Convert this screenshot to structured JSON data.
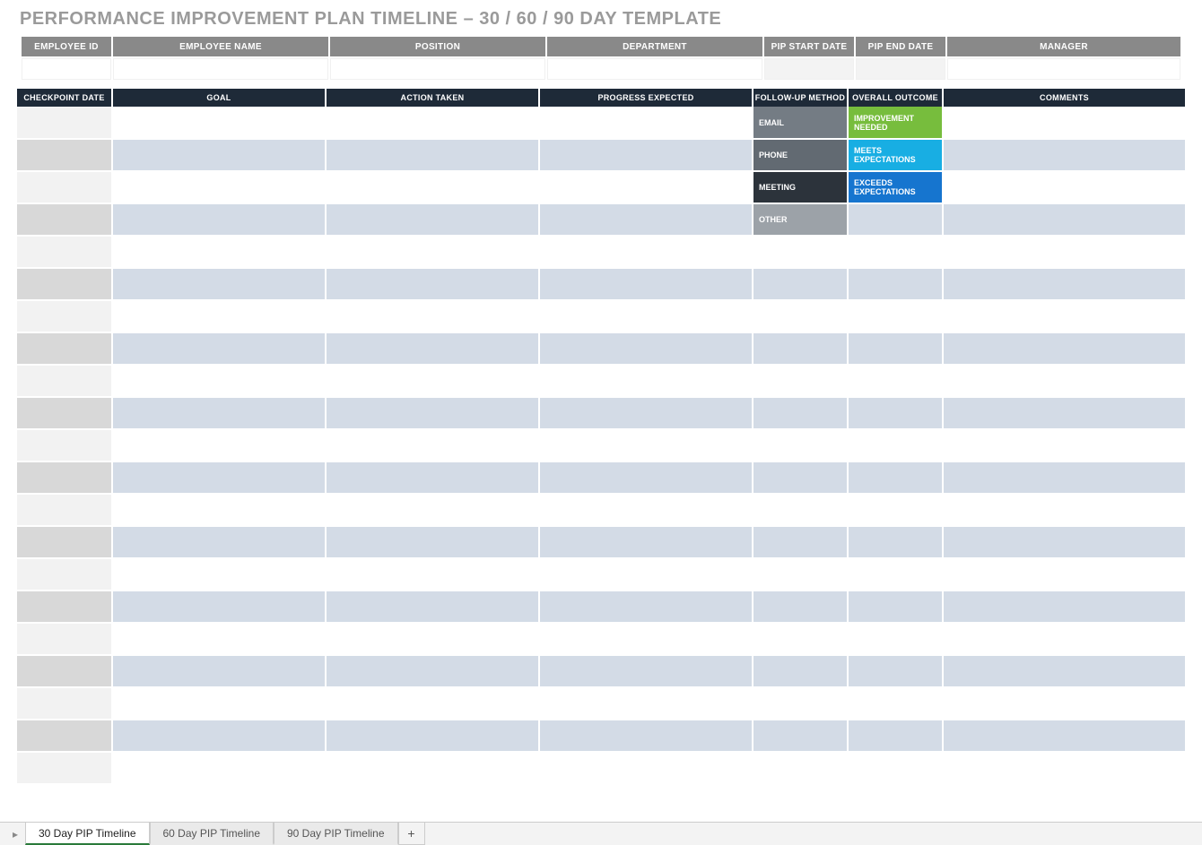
{
  "title": "PERFORMANCE IMPROVEMENT PLAN TIMELINE  –  30 / 60 / 90 DAY TEMPLATE",
  "empHeaders": {
    "id": "EMPLOYEE ID",
    "name": "EMPLOYEE NAME",
    "position": "POSITION",
    "department": "DEPARTMENT",
    "start": "PIP START DATE",
    "end": "PIP END DATE",
    "manager": "MANAGER"
  },
  "empValues": {
    "id": "",
    "name": "",
    "position": "",
    "department": "",
    "start": "",
    "end": "",
    "manager": ""
  },
  "cols": {
    "checkpoint": "CHECKPOINT DATE",
    "goal": "GOAL",
    "action": "ACTION TAKEN",
    "progress": "PROGRESS EXPECTED",
    "followup": "FOLLOW-UP METHOD",
    "outcome": "OVERALL OUTCOME",
    "comments": "COMMENTS"
  },
  "followups": {
    "email": "EMAIL",
    "phone": "PHONE",
    "meeting": "MEETING",
    "other": "OTHER"
  },
  "outcomes": {
    "improve": "IMPROVEMENT NEEDED",
    "meets": "MEETS EXPECTATIONS",
    "exceeds": "EXCEEDS EXPECTATIONS"
  },
  "tabs": {
    "t30": "30 Day PIP Timeline",
    "t60": "60 Day PIP Timeline",
    "t90": "90 Day PIP Timeline"
  },
  "rowCount": 21
}
